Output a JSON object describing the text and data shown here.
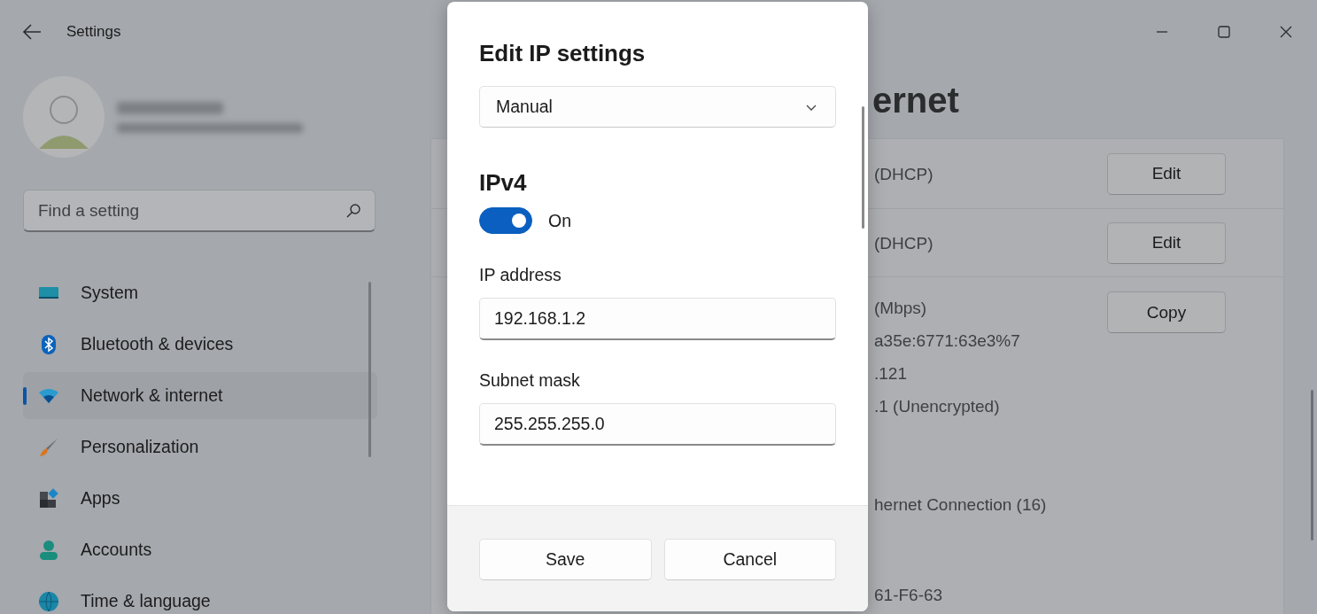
{
  "window": {
    "title": "Settings"
  },
  "search": {
    "placeholder": "Find a setting"
  },
  "nav": [
    {
      "label": "System",
      "kind": "system",
      "selected": false
    },
    {
      "label": "Bluetooth & devices",
      "kind": "bluetooth",
      "selected": false
    },
    {
      "label": "Network & internet",
      "kind": "network",
      "selected": true
    },
    {
      "label": "Personalization",
      "kind": "brush",
      "selected": false
    },
    {
      "label": "Apps",
      "kind": "apps",
      "selected": false
    },
    {
      "label": "Accounts",
      "kind": "accounts",
      "selected": false
    },
    {
      "label": "Time & language",
      "kind": "time",
      "selected": false
    }
  ],
  "page_title_fragments": [
    "ernet"
  ],
  "rows": [
    {
      "lines": [
        [
          "(DHCP)"
        ]
      ],
      "button": "Edit"
    },
    {
      "lines": [
        [
          "(DHCP)"
        ]
      ],
      "button": "Edit"
    },
    {
      "lines": [
        [
          "(Mbps)",
          "a35e:6771:63e3%7",
          ".121",
          ".1 (Unencrypted)"
        ],
        [
          "hernet Connection (16)"
        ],
        [
          "61-F6-63"
        ]
      ],
      "button": "Copy"
    }
  ],
  "dialog": {
    "title": "Edit IP settings",
    "mode": "Manual",
    "section": "IPv4",
    "toggle": {
      "on": true,
      "label": "On"
    },
    "fields": [
      {
        "label": "IP address",
        "value": "192.168.1.2"
      },
      {
        "label": "Subnet mask",
        "value": "255.255.255.0"
      }
    ],
    "buttons": [
      "Save",
      "Cancel"
    ]
  }
}
